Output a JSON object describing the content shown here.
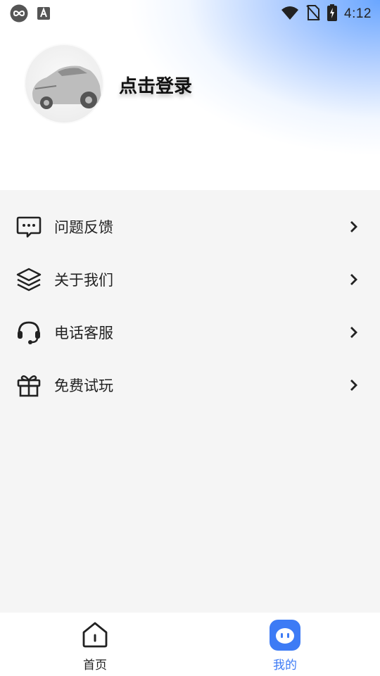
{
  "status_bar": {
    "time": "4:12",
    "left_icons": [
      "loop-app-icon",
      "text-a-icon"
    ],
    "right_icons": [
      "wifi-icon",
      "no-sim-icon",
      "battery-charging-icon"
    ]
  },
  "profile": {
    "login_text": "点击登录",
    "avatar": "car-avatar"
  },
  "menu": {
    "items": [
      {
        "label": "问题反馈",
        "icon": "feedback-chat-icon"
      },
      {
        "label": "关于我们",
        "icon": "layers-icon"
      },
      {
        "label": "电话客服",
        "icon": "headset-icon"
      },
      {
        "label": "免费试玩",
        "icon": "gift-icon"
      }
    ]
  },
  "bottom_nav": {
    "items": [
      {
        "label": "首页",
        "icon": "home-icon",
        "active": false
      },
      {
        "label": "我的",
        "icon": "profile-face-icon",
        "active": true
      }
    ]
  },
  "colors": {
    "accent": "#3d7bf5",
    "background": "#f5f5f5",
    "header_gradient": "#6aa6ff"
  }
}
